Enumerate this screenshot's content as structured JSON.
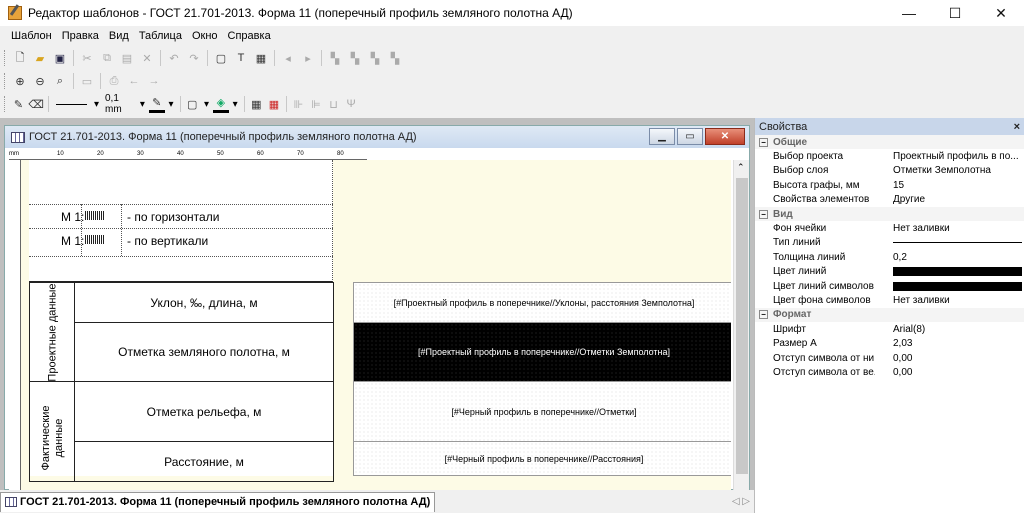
{
  "window": {
    "title": "Редактор шаблонов - ГОСТ 21.701-2013. Форма 11 (поперечный профиль земляного полотна АД)",
    "minimize": "—",
    "maximize": "☐",
    "close": "✕"
  },
  "menu": [
    "Шаблон",
    "Правка",
    "Вид",
    "Таблица",
    "Окно",
    "Справка"
  ],
  "toolbar3": {
    "line_width": "0,1 mm"
  },
  "document": {
    "title": "ГОСТ 21.701-2013. Форма 11 (поперечный профиль земляного полотна АД)",
    "ruler_labels": [
      "mm",
      "10",
      "20",
      "30",
      "40",
      "50",
      "60",
      "70",
      "80"
    ],
    "scale_rows": [
      {
        "prefix": "М 1:",
        "label": "- по горизонтали"
      },
      {
        "prefix": "М 1:",
        "label": "- по вертикали"
      }
    ],
    "groups": [
      {
        "label": "Проектные данные"
      },
      {
        "label": "Фактические данные"
      }
    ],
    "rows": [
      {
        "label": "Уклон, ‰, длина, м",
        "field": "[#Проектный профиль в поперечнике//Уклоны, расстояния Земполотна]"
      },
      {
        "label": "Отметка земляного полотна, м",
        "field": "[#Проектный профиль в поперечнике//Отметки Земполотна]"
      },
      {
        "label": "Отметка рельефа, м",
        "field": "[#Черный профиль в поперечнике//Отметки]"
      },
      {
        "label": "Расстояние, м",
        "field": "[#Черный профиль в поперечнике//Расстояния]"
      }
    ]
  },
  "tab": {
    "label": "ГОСТ 21.701-2013. Форма 11 (поперечный профиль земляного полотна АД)"
  },
  "properties": {
    "title": "Свойства",
    "close": "×",
    "groups": [
      {
        "name": "Общие",
        "items": [
          {
            "name": "Выбор проекта",
            "value": "Проектный профиль в по..."
          },
          {
            "name": "Выбор слоя",
            "value": "Отметки Земполотна"
          },
          {
            "name": "Высота графы, мм",
            "value": "15"
          },
          {
            "name": "Свойства элементов",
            "value": "Другие"
          }
        ]
      },
      {
        "name": "Вид",
        "items": [
          {
            "name": "Фон ячейки",
            "value": "Нет заливки"
          },
          {
            "name": "Тип линий",
            "value": ""
          },
          {
            "name": "Толщина линий",
            "value": "0,2"
          },
          {
            "name": "Цвет линий",
            "value": ""
          },
          {
            "name": "Цвет линий символов",
            "value": ""
          },
          {
            "name": "Цвет фона символов",
            "value": "Нет заливки"
          }
        ]
      },
      {
        "name": "Формат",
        "items": [
          {
            "name": "Шрифт",
            "value": "Arial(8)"
          },
          {
            "name": "Размер А",
            "value": "2,03"
          },
          {
            "name": "Отступ символа от ни...",
            "value": "0,00"
          },
          {
            "name": "Отступ символа от ве...",
            "value": "0,00"
          }
        ]
      }
    ]
  }
}
